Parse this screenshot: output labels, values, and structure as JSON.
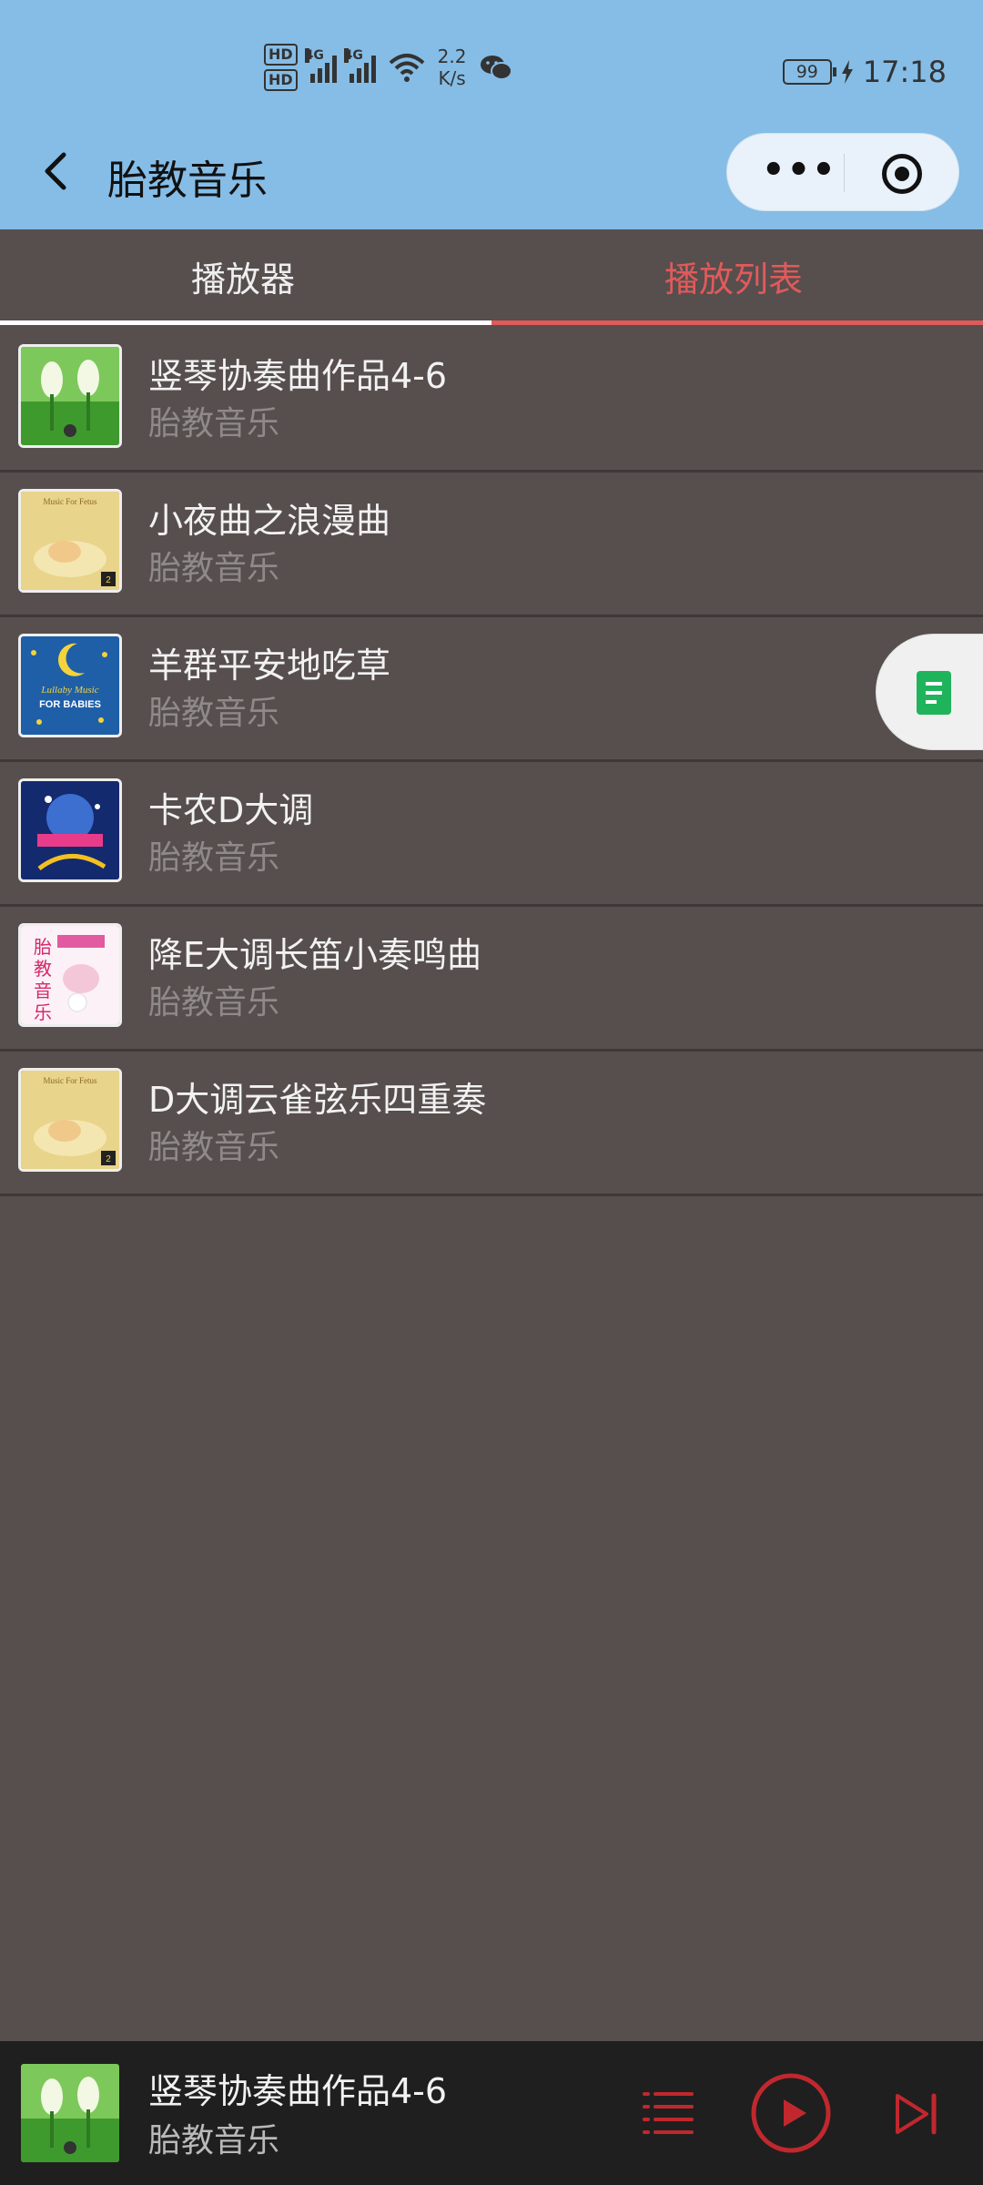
{
  "status": {
    "hd1": "HD",
    "hd2": "HD",
    "net1": "4G",
    "net2": "4G",
    "speed_value": "2.2",
    "speed_unit": "K/s",
    "battery": "99",
    "time": "17:18"
  },
  "nav": {
    "title": "胎教音乐",
    "more_label": "•••"
  },
  "tabs": [
    {
      "label": "播放器",
      "active": false
    },
    {
      "label": "播放列表",
      "active": true
    }
  ],
  "playlist": [
    {
      "title": "竖琴协奏曲作品4-6",
      "subtitle": "胎教音乐",
      "cover_icon": "green-flowers-cover"
    },
    {
      "title": "小夜曲之浪漫曲",
      "subtitle": "胎教音乐",
      "cover_icon": "sleeping-baby-cover"
    },
    {
      "title": "羊群平安地吃草",
      "subtitle": "胎教音乐",
      "cover_icon": "lullaby-moon-cover"
    },
    {
      "title": "卡农D大调",
      "subtitle": "胎教音乐",
      "cover_icon": "blue-music-cover"
    },
    {
      "title": "降E大调长笛小奏鸣曲",
      "subtitle": "胎教音乐",
      "cover_icon": "pink-baby-cover"
    },
    {
      "title": "D大调云雀弦乐四重奏",
      "subtitle": "胎教音乐",
      "cover_icon": "sleeping-baby-cover"
    }
  ],
  "cover_texts": {
    "music_for_fetus": "Music For Fetus",
    "lullaby": "Lullaby Music",
    "for_babies": "FOR BABIES",
    "badge": "2",
    "taijiao": [
      "胎",
      "教",
      "音",
      "乐"
    ]
  },
  "player": {
    "title": "竖琴协奏曲作品4-6",
    "subtitle": "胎教音乐"
  },
  "colors": {
    "accent": "#e15a5a",
    "background": "#574e4e",
    "header": "#85bde6",
    "player_bar": "#1f1f1f"
  }
}
